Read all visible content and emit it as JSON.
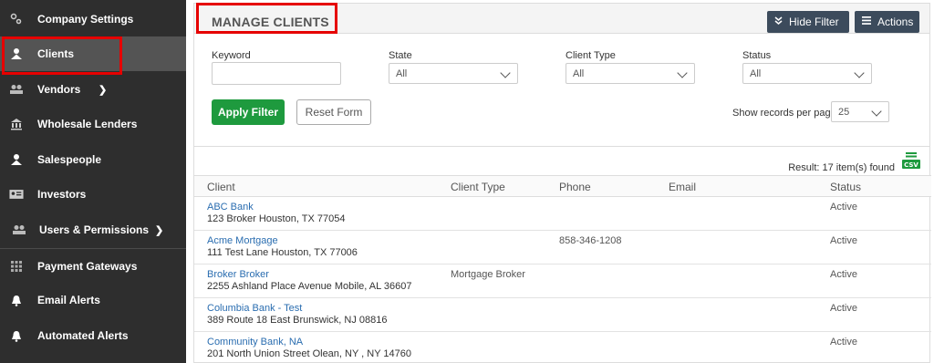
{
  "sidebar": {
    "items": [
      {
        "label": "Company Settings",
        "icon": "gears-icon"
      },
      {
        "label": "Clients",
        "icon": "user-icon"
      },
      {
        "label": "Vendors",
        "icon": "users-icon"
      },
      {
        "label": "Wholesale Lenders",
        "icon": "bank-icon"
      },
      {
        "label": "Salespeople",
        "icon": "user-icon"
      },
      {
        "label": "Investors",
        "icon": "id-card-icon"
      },
      {
        "label": "Users & Permissions",
        "icon": "users-icon"
      },
      {
        "label": "Payment Gateways",
        "icon": "grid-icon"
      },
      {
        "label": "Email Alerts",
        "icon": "bell-icon"
      },
      {
        "label": "Automated Alerts",
        "icon": "bell-icon"
      }
    ]
  },
  "header": {
    "title": "MANAGE CLIENTS",
    "hide_filter_label": "Hide Filter",
    "actions_label": "Actions"
  },
  "filters": {
    "keyword_label": "Keyword",
    "keyword_value": "",
    "state_label": "State",
    "state_value": "All",
    "client_type_label": "Client Type",
    "client_type_value": "All",
    "status_label": "Status",
    "status_value": "All",
    "apply_label": "Apply Filter",
    "reset_label": "Reset Form",
    "records_per_page_label": "Show records per page",
    "records_per_page_value": "25"
  },
  "results": {
    "count_text": "Result: 17 item(s) found",
    "csv_label": "CSV",
    "columns": [
      "Client",
      "Client Type",
      "Phone",
      "Email",
      "Status"
    ],
    "rows": [
      {
        "name": "ABC Bank",
        "address": "123 Broker Houston, TX 77054",
        "type": "",
        "phone": "",
        "email": "",
        "status": "Active"
      },
      {
        "name": "Acme Mortgage",
        "address": "111 Test Lane  Houston, TX 77006",
        "type": "",
        "phone": "858-346-1208",
        "email": "",
        "status": "Active"
      },
      {
        "name": "Broker Broker",
        "address": "2255 Ashland Place Avenue Mobile, AL 36607",
        "type": "Mortgage Broker",
        "phone": "",
        "email": "",
        "status": "Active"
      },
      {
        "name": "Columbia Bank - Test",
        "address": "389 Route 18 East Brunswick, NJ 08816",
        "type": "",
        "phone": "",
        "email": "",
        "status": "Active"
      },
      {
        "name": "Community Bank, NA",
        "address": "201 North Union Street Olean, NY , NY 14760",
        "type": "",
        "phone": "",
        "email": "",
        "status": "Active"
      }
    ]
  },
  "colors": {
    "sidebar_bg": "#2e2e2e",
    "sidebar_active": "#545454",
    "highlight": "#e60000",
    "green_button": "#1e9a3e",
    "dark_button": "#3c4b5c",
    "link": "#2a6db0"
  }
}
